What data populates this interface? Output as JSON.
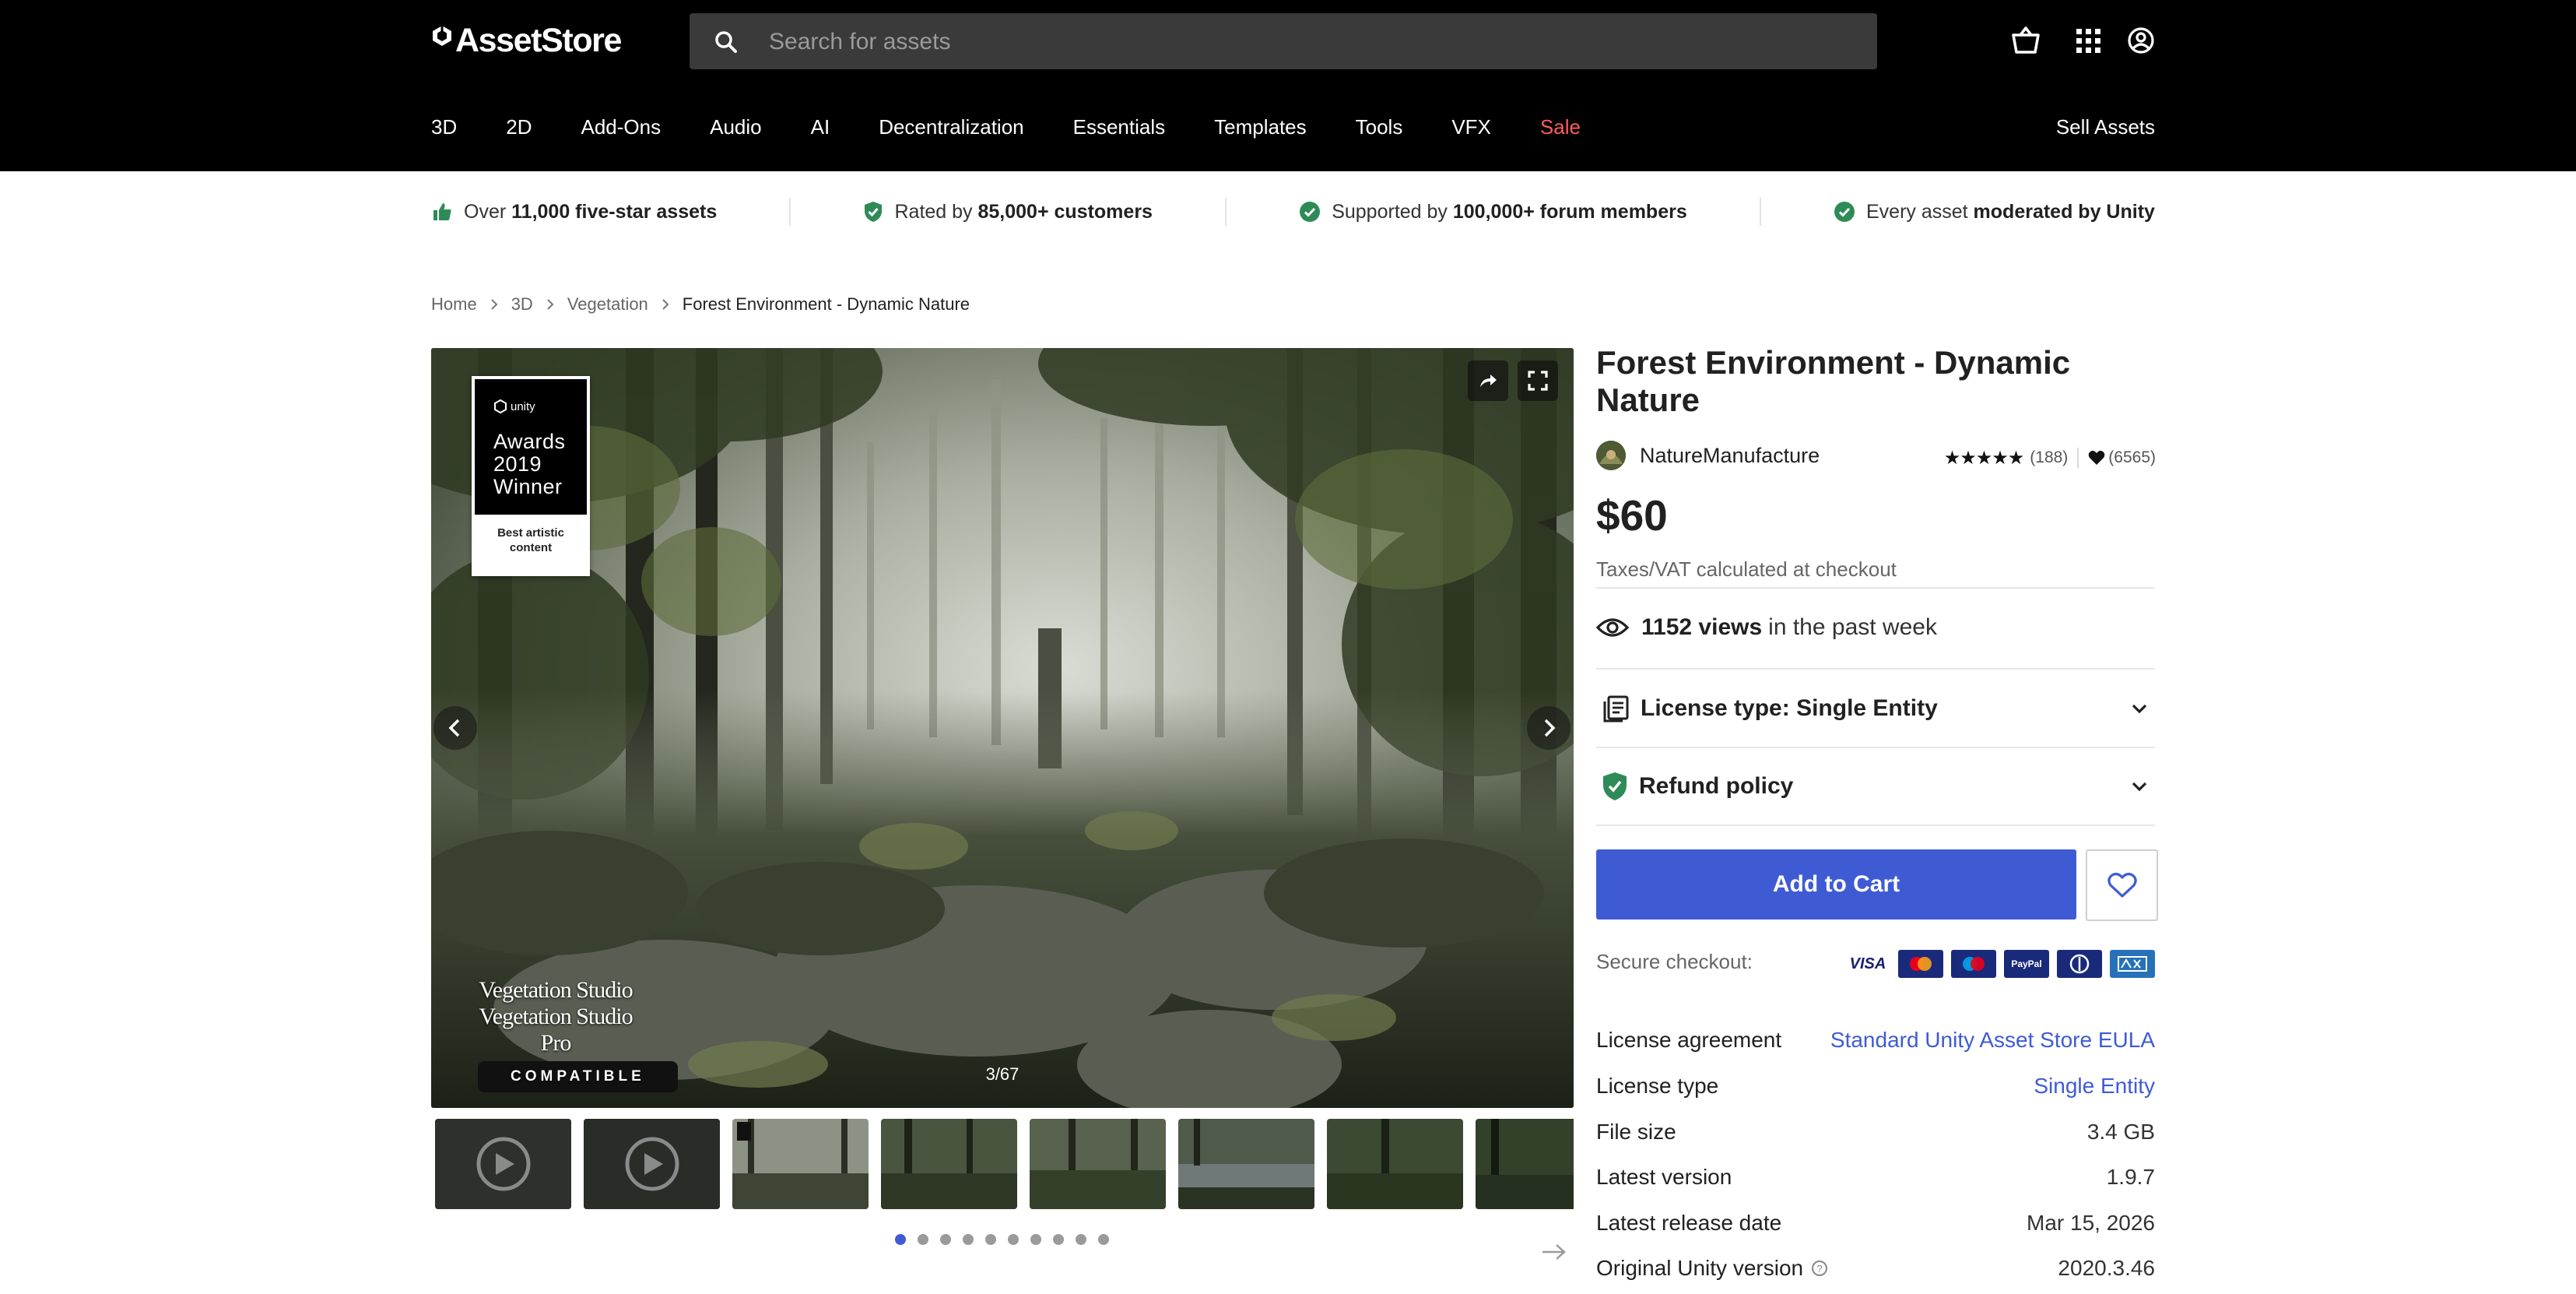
{
  "header": {
    "logo_text": "AssetStore",
    "search_placeholder": "Search for assets",
    "icons": [
      "cart-icon",
      "apps-grid-icon",
      "account-icon"
    ],
    "nav": [
      "3D",
      "2D",
      "Add-Ons",
      "Audio",
      "AI",
      "Decentralization",
      "Essentials",
      "Templates",
      "Tools",
      "VFX",
      "Sale"
    ],
    "sell_assets": "Sell Assets",
    "sale_color": "#ff5c5c"
  },
  "trust": {
    "item1_pre": "Over ",
    "item1_bold": "11,000 five-star assets",
    "item2_pre": "Rated by ",
    "item2_bold": "85,000+ customers",
    "item3_pre": "Supported by ",
    "item3_bold": "100,000+ forum members",
    "item4_pre": "Every asset ",
    "item4_bold": "moderated by Unity",
    "check_color": "#2e8b57"
  },
  "breadcrumb": [
    "Home",
    "3D",
    "Vegetation",
    "Forest Environment - Dynamic Nature"
  ],
  "gallery": {
    "award_brand": "unity",
    "award_line1": "Awards",
    "award_line2": "2019",
    "award_line3": "Winner",
    "award_category_1": "Best artistic",
    "award_category_2": "content",
    "badge_line1": "Vegetation Studio",
    "badge_line2": "Vegetation Studio Pro",
    "badge_line3": "COMPATIBLE",
    "counter": "3/67",
    "thumbnail_count": 8,
    "dots": 10,
    "active_dot": 0
  },
  "product": {
    "title": "Forest Environment - Dynamic Nature",
    "publisher": "NatureManufacture",
    "stars": "★★★★★",
    "rating_count": "(188)",
    "favorites": "(6565)",
    "price": "$60",
    "tax_note": "Taxes/VAT calculated at checkout",
    "views_count": "1152 views",
    "views_suffix": "in the past week",
    "license_accordion": "License type: Single Entity",
    "refund_accordion": "Refund policy",
    "add_to_cart": "Add to Cart",
    "secure_checkout": "Secure checkout:",
    "payment_methods": [
      "VISA",
      "Mastercard",
      "Maestro",
      "PayPal",
      "Diners Club",
      "American Express"
    ],
    "accent_color": "#3f5bd4"
  },
  "details": [
    {
      "label": "License agreement",
      "value": "Standard Unity Asset Store EULA",
      "link": true
    },
    {
      "label": "License type",
      "value": "Single Entity",
      "link": true
    },
    {
      "label": "File size",
      "value": "3.4 GB",
      "link": false
    },
    {
      "label": "Latest version",
      "value": "1.9.7",
      "link": false
    },
    {
      "label": "Latest release date",
      "value": "Mar 15, 2026",
      "link": false
    },
    {
      "label": "Original Unity version",
      "value": "2020.3.46",
      "link": false
    }
  ]
}
